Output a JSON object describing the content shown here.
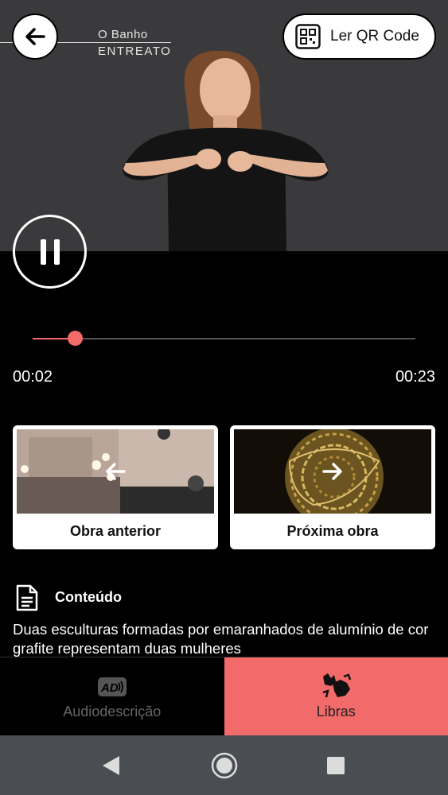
{
  "header": {
    "title_line1": "O Banho",
    "title_line2": "ENTREATO",
    "qr_button_label": "Ler QR Code"
  },
  "player": {
    "state": "playing",
    "current_time": "00:02",
    "total_time": "00:23",
    "progress_fraction": 0.11
  },
  "navigation_cards": [
    {
      "label": "Obra anterior",
      "direction": "previous"
    },
    {
      "label": "Próxima obra",
      "direction": "next"
    }
  ],
  "content": {
    "heading": "Conteúdo",
    "text": "Duas esculturas formadas por emaranhados de alumínio de cor grafite representam duas mulheres"
  },
  "tabs": [
    {
      "label": "Audiodescrição",
      "icon": "audio-description-icon",
      "active": false
    },
    {
      "label": "Libras",
      "icon": "sign-language-icon",
      "active": true
    }
  ],
  "colors": {
    "accent": "#f26a6a",
    "background": "#000000",
    "video_background": "#3a3a3c",
    "system_nav": "#4a4d52"
  }
}
